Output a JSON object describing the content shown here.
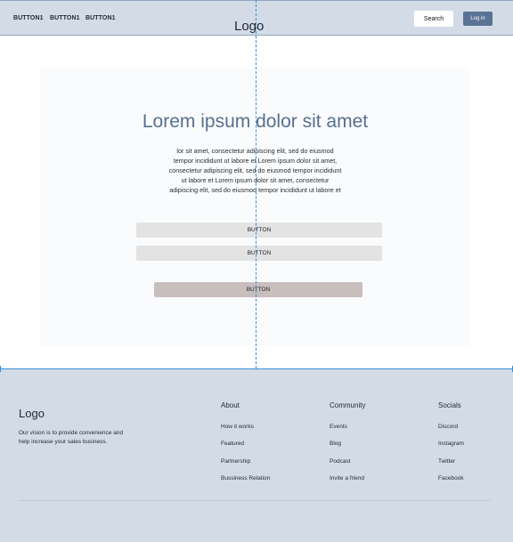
{
  "header": {
    "nav": [
      "BUTTON1",
      "BUTTON1",
      "BUTTON1"
    ],
    "logo": "Logo",
    "search_label": "Search",
    "login_label": "Log in"
  },
  "hero": {
    "title": "Lorem ipsum dolor sit amet",
    "body_lines": [
      "lor sit amet, consectetur adipiscing elit, sed do eiusmod",
      "tempor incididunt ut labore et Lorem ipsum dolor sit amet,",
      "consectetur adipiscing elit, sed do eiusmod tempor incididunt",
      "ut labore et Lorem ipsum dolor sit amet, consectetur",
      "adipiscing elit, sed do eiusmod tempor incididunt ut labore et"
    ],
    "buttons": [
      "BUTTON",
      "BUTTON",
      "BUTTON"
    ]
  },
  "footer": {
    "logo": "Logo",
    "tagline": "Our vision is to provide convenience and help increase your sales business.",
    "columns": [
      {
        "title": "About",
        "links": [
          "How it works",
          "Featured",
          "Partnership",
          "Bussiness Relation"
        ]
      },
      {
        "title": "Community",
        "links": [
          "Events",
          "Blog",
          "Podcast",
          "Invite a friend"
        ]
      },
      {
        "title": "Socials",
        "links": [
          "Discord",
          "Instagram",
          "Twitter",
          "Facebook"
        ]
      }
    ]
  },
  "colors": {
    "header_bg": "#d3dbe6",
    "hero_title": "#56708f",
    "login_bg": "#5a7394",
    "guide_line": "#3a8fd6"
  }
}
